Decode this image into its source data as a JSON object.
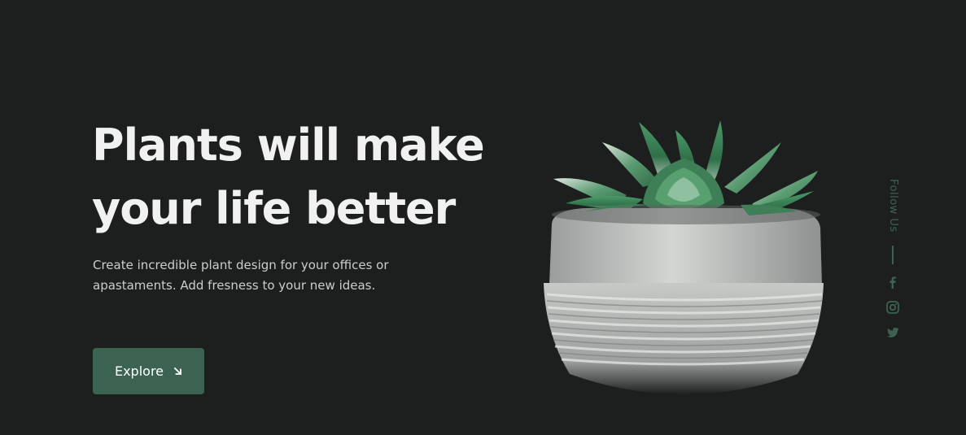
{
  "hero": {
    "title_line1": "Plants will make",
    "title_line2": "your life better",
    "description": "Create incredible plant design for your offices or apastaments. Add fresness to your new ideas.",
    "explore_label": "Explore",
    "explore_icon": "arrow-down-right-icon"
  },
  "follow": {
    "label": "Follow Us",
    "icons": [
      "facebook-icon",
      "instagram-icon",
      "twitter-icon"
    ]
  },
  "colors": {
    "background": "#1c1f1e",
    "accent": "#3c6352",
    "title": "#f1f1f1",
    "text": "#c9cfcb"
  }
}
